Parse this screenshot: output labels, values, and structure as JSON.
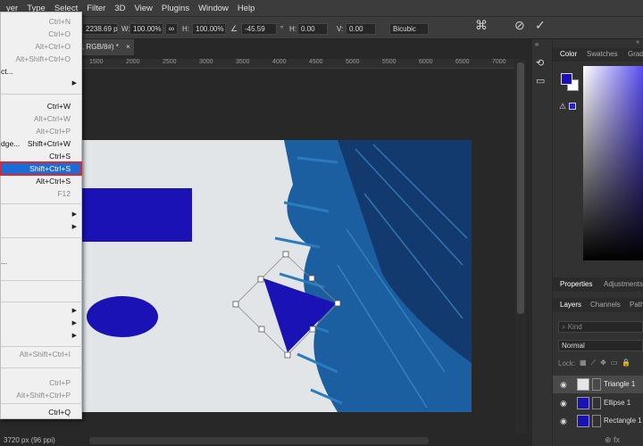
{
  "menubar": {
    "items": [
      "yer",
      "Type",
      "Select",
      "Filter",
      "3D",
      "View",
      "Plugins",
      "Window",
      "Help"
    ]
  },
  "options": {
    "x_value": "2238.69 p",
    "w_label": "W:",
    "w_value": "100.00%",
    "h_label": "H:",
    "h_value": "100.00%",
    "angle_value": "-45.59",
    "degree": "°",
    "hskew_label": "H:",
    "hskew_value": "0.00",
    "vskew_label": "V:",
    "vskew_value": "0.00",
    "interpolation": "Bicubic"
  },
  "document": {
    "tab_title": ", RGB/8#) *",
    "tab_close": "×",
    "ruler_ticks": [
      "1500",
      "2000",
      "2500",
      "3000",
      "3500",
      "4000",
      "4500",
      "5000",
      "5500",
      "6000",
      "6500",
      "7000"
    ],
    "status": "3720 px (96 ppi)"
  },
  "file_menu": {
    "items": [
      {
        "label": "",
        "shortcut": "Ctrl+N",
        "disabled": true
      },
      {
        "label": "",
        "shortcut": "Ctrl+O",
        "disabled": true
      },
      {
        "label": "",
        "shortcut": "Alt+Ctrl+O",
        "disabled": true
      },
      {
        "label": "",
        "shortcut": "Alt+Shift+Ctrl+O",
        "disabled": true
      },
      {
        "label": "ct...",
        "shortcut": "",
        "disabled": false
      },
      {
        "label": "",
        "shortcut": "",
        "disabled": false,
        "submenu": true
      },
      {
        "label": "",
        "shortcut": "Ctrl+W",
        "disabled": false
      },
      {
        "label": "",
        "shortcut": "Alt+Ctrl+W",
        "disabled": true
      },
      {
        "label": "",
        "shortcut": "Alt+Ctrl+P",
        "disabled": true
      },
      {
        "label": "dge...",
        "shortcut": "Shift+Ctrl+W",
        "disabled": false
      },
      {
        "label": "",
        "shortcut": "Ctrl+S",
        "disabled": false
      },
      {
        "label": "",
        "shortcut": "Shift+Ctrl+S",
        "disabled": false,
        "highlighted": true
      },
      {
        "label": "",
        "shortcut": "Alt+Ctrl+S",
        "disabled": false
      },
      {
        "label": "",
        "shortcut": "F12",
        "disabled": true
      },
      {
        "label": "",
        "shortcut": "",
        "disabled": false,
        "submenu": true
      },
      {
        "label": "",
        "shortcut": "",
        "disabled": false,
        "submenu": true
      },
      {
        "label": "...",
        "shortcut": "",
        "disabled": false
      },
      {
        "label": "",
        "shortcut": "",
        "disabled": false,
        "submenu": true
      },
      {
        "label": "",
        "shortcut": "",
        "disabled": false,
        "submenu": true
      },
      {
        "label": "",
        "shortcut": "",
        "disabled": false,
        "submenu": true
      },
      {
        "label": "",
        "shortcut": "Alt+Shift+Ctrl+I",
        "disabled": true
      },
      {
        "label": "",
        "shortcut": "Ctrl+P",
        "disabled": true
      },
      {
        "label": "",
        "shortcut": "Alt+Shift+Ctrl+P",
        "disabled": true
      },
      {
        "label": "",
        "shortcut": "Ctrl+Q",
        "disabled": false
      }
    ]
  },
  "panels": {
    "color_tabs": [
      "Color",
      "Swatches",
      "Grad"
    ],
    "prop_tabs": [
      "Properties",
      "Adjustments"
    ],
    "layer_tabs": [
      "Layers",
      "Channels",
      "Path"
    ],
    "kind_placeholder": "Kind",
    "blend_mode": "Normal",
    "lock_label": "Lock:",
    "layers": [
      {
        "name": "Triangle 1",
        "selected": true
      },
      {
        "name": "Ellipse 1",
        "selected": false
      },
      {
        "name": "Rectangle 1",
        "selected": false
      }
    ],
    "footer_icons": "⊕  fx"
  },
  "colors": {
    "foreground": "#1a0fb8",
    "shape_blue": "#1a12b4",
    "paint_blue": "#1c5fa0",
    "menu_highlight": "#1c6cd8",
    "highlight_border": "#e0262b"
  }
}
